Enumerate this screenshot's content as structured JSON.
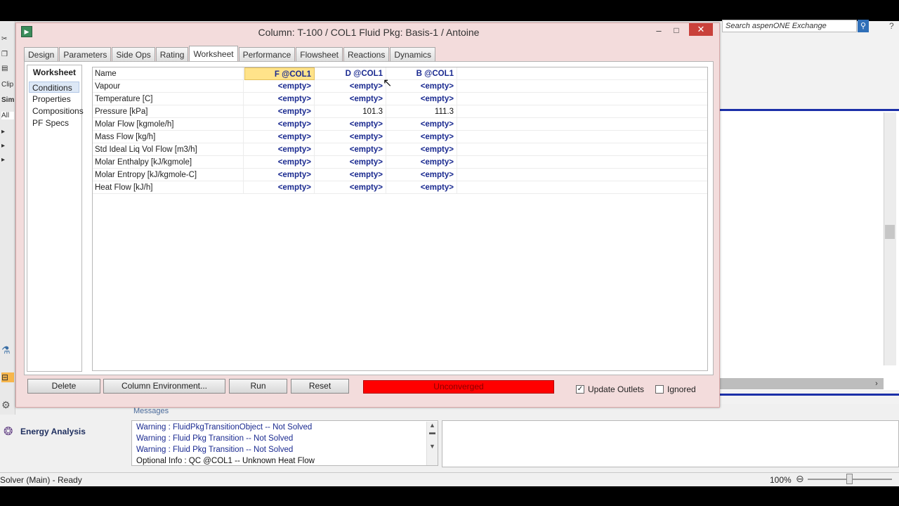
{
  "dialog": {
    "title": "Column: T-100 / COL1  Fluid Pkg: Basis-1 / Antoine",
    "tabs": [
      "Design",
      "Parameters",
      "Side Ops",
      "Rating",
      "Worksheet",
      "Performance",
      "Flowsheet",
      "Reactions",
      "Dynamics"
    ],
    "active_tab": "Worksheet",
    "window_buttons": {
      "minimize": "‒",
      "maximize": "□",
      "close": "✕"
    }
  },
  "sidenav": {
    "title": "Worksheet",
    "items": [
      "Conditions",
      "Properties",
      "Compositions",
      "PF Specs"
    ],
    "selected": "Conditions"
  },
  "table": {
    "headers": [
      "Name",
      "F @COL1",
      "D @COL1",
      "B @COL1"
    ],
    "rows": [
      [
        "Vapour",
        "<empty>",
        "<empty>",
        "<empty>"
      ],
      [
        "Temperature [C]",
        "<empty>",
        "<empty>",
        "<empty>"
      ],
      [
        "Pressure [kPa]",
        "<empty>",
        "101.3",
        "111.3"
      ],
      [
        "Molar Flow [kgmole/h]",
        "<empty>",
        "<empty>",
        "<empty>"
      ],
      [
        "Mass Flow [kg/h]",
        "<empty>",
        "<empty>",
        "<empty>"
      ],
      [
        "Std Ideal Liq Vol Flow [m3/h]",
        "<empty>",
        "<empty>",
        "<empty>"
      ],
      [
        "Molar Enthalpy [kJ/kgmole]",
        "<empty>",
        "<empty>",
        "<empty>"
      ],
      [
        "Molar Entropy [kJ/kgmole-C]",
        "<empty>",
        "<empty>",
        "<empty>"
      ],
      [
        "Heat Flow [kJ/h]",
        "<empty>",
        "<empty>",
        "<empty>"
      ]
    ]
  },
  "buttons": {
    "delete": "Delete",
    "column_environment": "Column Environment...",
    "run": "Run",
    "reset": "Reset"
  },
  "status": {
    "label": "Unconverged",
    "color": "#ff0000"
  },
  "checkboxes": {
    "update_outlets": {
      "label": "Update Outlets",
      "checked": true
    },
    "ignored": {
      "label": "Ignored",
      "checked": false
    }
  },
  "background": {
    "search_placeholder": "Search aspenONE Exchange",
    "left_strip": [
      "Clip",
      "Sim",
      "All"
    ],
    "energy_analysis": "Energy Analysis",
    "messages_title": "Messages",
    "messages": [
      "Warning  : FluidPkgTransitionObject -- Not Solved",
      "Warning  : Fluid Pkg Transition -- Not Solved",
      "Warning  : Fluid Pkg Transition -- Not Solved",
      "Optional Info  : QC @COL1 -- Unknown Heat Flow"
    ],
    "status_text": "Solver (Main) - Ready",
    "zoom": "100%"
  }
}
